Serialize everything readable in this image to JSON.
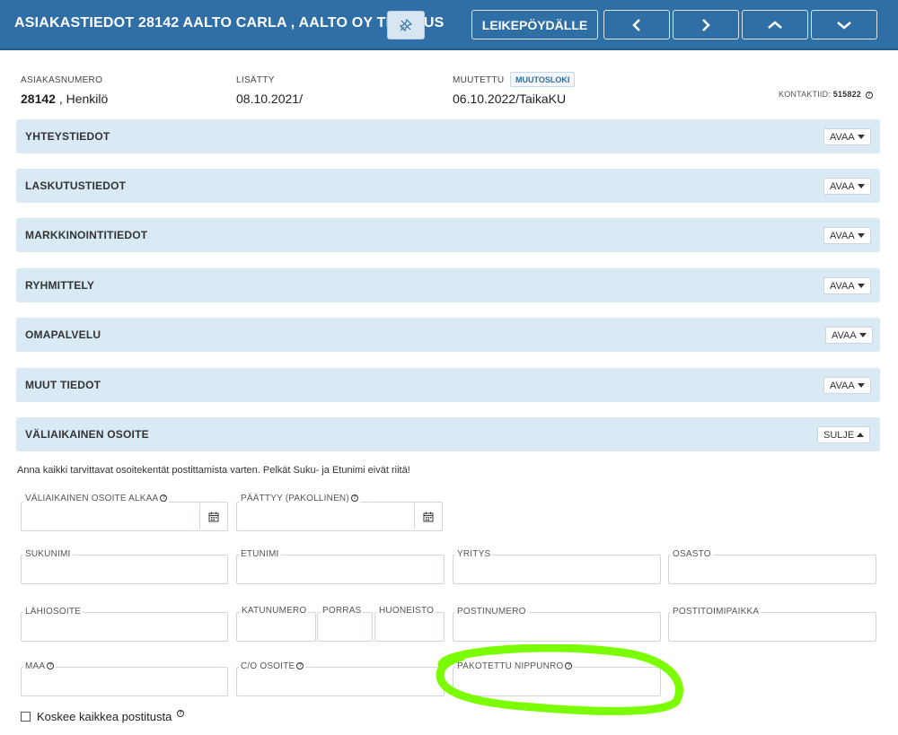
{
  "header": {
    "title": "ASIAKASTIEDOT 28142 AALTO CARLA , AALTO OY TESTAUS",
    "clipboard_label": "LEIKEPÖYDÄLLE",
    "pin_icon": "pin-off-icon",
    "nav_icons": [
      "chevron-left-icon",
      "chevron-right-icon",
      "chevron-up-icon",
      "chevron-down-icon"
    ]
  },
  "info": {
    "customer_number_label": "ASIAKASNUMERO",
    "customer_number": "28142",
    "customer_type": " , Henkilö",
    "added_label": "LISÄTTY",
    "added_value": "08.10.2021/",
    "modified_label": "MUUTETTU",
    "changelog_label": "MUUTOSLOKI",
    "modified_value": "06.10.2022/TaikaKU",
    "contact_id_label": "KONTAKTIID:",
    "contact_id": "515822"
  },
  "sections": [
    {
      "title": "YHTEYSTIEDOT",
      "toggle": "AVAA"
    },
    {
      "title": "LASKUTUSTIEDOT",
      "toggle": "AVAA"
    },
    {
      "title": "MARKKINOINTITIEDOT",
      "toggle": "AVAA"
    },
    {
      "title": "RYHMITTELY",
      "toggle": "AVAA"
    },
    {
      "title": "OMAPALVELU",
      "toggle": "AVAA"
    },
    {
      "title": "MUUT TIEDOT",
      "toggle": "AVAA"
    },
    {
      "title": "VÄLIAIKAINEN OSOITE",
      "toggle": "SULJE"
    }
  ],
  "temp_address": {
    "note": "Anna kaikki tarvittavat osoitekentät postittamista varten. Pelkät Suku- ja Etunimi eivät riitä!",
    "start_label": "VÄLIAIKAINEN OSOITE ALKAA",
    "end_label": "PÄÄTTYY (PAKOLLINEN)",
    "sukunimi_label": "SUKUNIMI",
    "etunimi_label": "ETUNIMI",
    "yritys_label": "YRITYS",
    "osasto_label": "OSASTO",
    "lahiosoite_label": "LÄHIOSOITE",
    "katunumero_label": "KATUNUMERO",
    "porras_label": "PORRAS",
    "huoneisto_label": "HUONEISTO",
    "postinumero_label": "POSTINUMERO",
    "postitoimipaikka_label": "POSTITOIMIPAIKKA",
    "maa_label": "MAA",
    "co_label": "C/O OSOITE",
    "nippunro_label": "PAKOTETTU NIPPUNRO",
    "checkbox_label": "Koskee kaikkea postitusta"
  },
  "colors": {
    "header_bg": "#2f6fa6",
    "panel_bg": "#daeaf5",
    "highlight": "#7cfc00"
  }
}
